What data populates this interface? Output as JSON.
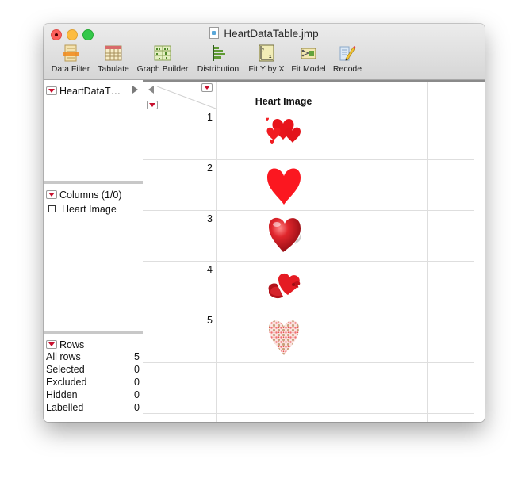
{
  "window": {
    "title": "HeartDataTable.jmp",
    "file_icon": "jmp-document-icon"
  },
  "toolbar": {
    "items": [
      {
        "label": "Data Filter",
        "icon": "data-filter-icon"
      },
      {
        "label": "Tabulate",
        "icon": "tabulate-icon"
      },
      {
        "label": "Graph Builder",
        "icon": "graph-builder-icon"
      },
      {
        "label": "Distribution",
        "icon": "distribution-icon"
      },
      {
        "label": "Fit Y by X",
        "icon": "fit-y-by-x-icon"
      },
      {
        "label": "Fit Model",
        "icon": "fit-model-icon"
      },
      {
        "label": "Recode",
        "icon": "recode-icon"
      }
    ]
  },
  "left_panel": {
    "table_panel": {
      "label": "HeartDataT…"
    },
    "columns_panel": {
      "label": "Columns (1/0)",
      "columns": [
        {
          "name": "Heart Image"
        }
      ]
    },
    "rows_panel": {
      "label": "Rows",
      "stats": [
        {
          "label": "All rows",
          "value": "5"
        },
        {
          "label": "Selected",
          "value": "0"
        },
        {
          "label": "Excluded",
          "value": "0"
        },
        {
          "label": "Hidden",
          "value": "0"
        },
        {
          "label": "Labelled",
          "value": "0"
        }
      ]
    }
  },
  "table": {
    "columns": [
      "Heart Image"
    ],
    "rows": [
      {
        "row": "1",
        "image": "cluster-of-red-hearts"
      },
      {
        "row": "2",
        "image": "solid-red-heart"
      },
      {
        "row": "3",
        "image": "glossy-3d-red-heart"
      },
      {
        "row": "4",
        "image": "heart-gift-box-with-bow"
      },
      {
        "row": "5",
        "image": "heart-made-of-small-hearts"
      }
    ]
  },
  "colors": {
    "accent_red": "#c8102e",
    "heart_red": "#f21c24"
  }
}
